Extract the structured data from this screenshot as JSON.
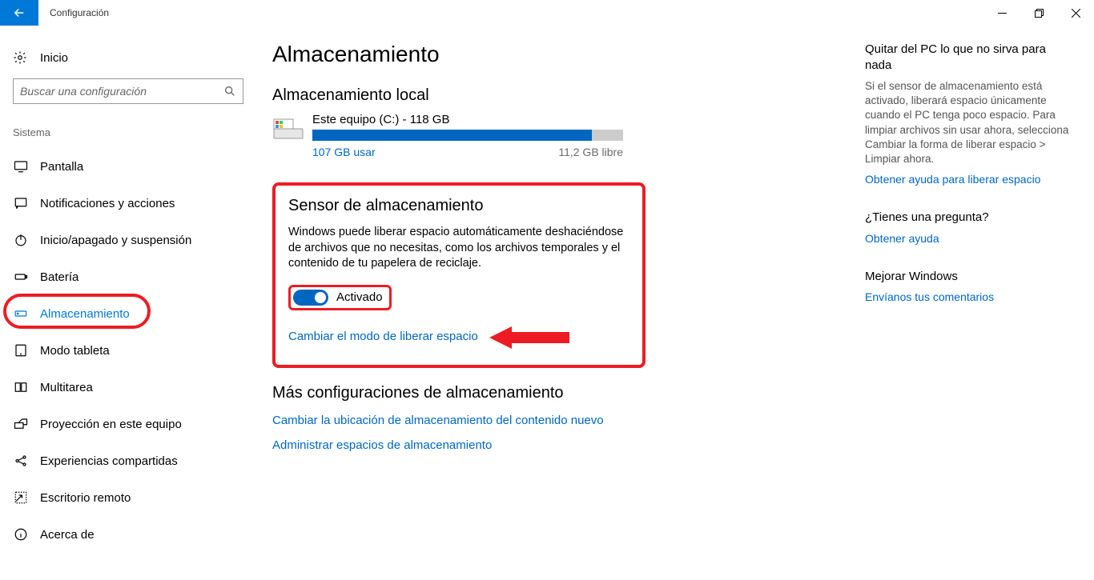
{
  "titlebar": {
    "app_title": "Configuración"
  },
  "sidebar": {
    "home_label": "Inicio",
    "search_placeholder": "Buscar una configuración",
    "group_label": "Sistema",
    "items": [
      {
        "label": "Pantalla",
        "icon": "display"
      },
      {
        "label": "Notificaciones y acciones",
        "icon": "chat"
      },
      {
        "label": "Inicio/apagado y suspensión",
        "icon": "power"
      },
      {
        "label": "Batería",
        "icon": "battery"
      },
      {
        "label": "Almacenamiento",
        "icon": "storage",
        "selected": true
      },
      {
        "label": "Modo tableta",
        "icon": "tablet"
      },
      {
        "label": "Multitarea",
        "icon": "multitask"
      },
      {
        "label": "Proyección en este equipo",
        "icon": "project"
      },
      {
        "label": "Experiencias compartidas",
        "icon": "share"
      },
      {
        "label": "Escritorio remoto",
        "icon": "remote"
      },
      {
        "label": "Acerca de",
        "icon": "info"
      }
    ]
  },
  "main": {
    "page_title": "Almacenamiento",
    "local_storage_heading": "Almacenamiento local",
    "drive": {
      "name": "Este equipo (C:) - 118 GB",
      "used_label": "107 GB usar",
      "free_label": "11,2 GB libre",
      "used_pct": 90
    },
    "sensor": {
      "heading": "Sensor de almacenamiento",
      "desc": "Windows puede liberar espacio automáticamente deshaciéndose de archivos que no necesitas, como los archivos temporales y el contenido de tu papelera de reciclaje.",
      "toggle_label": "Activado",
      "change_link": "Cambiar el modo de liberar espacio"
    },
    "more": {
      "heading": "Más configuraciones de almacenamiento",
      "link1": "Cambiar la ubicación de almacenamiento del contenido nuevo",
      "link2": "Administrar espacios de almacenamiento"
    }
  },
  "right": {
    "remove": {
      "heading": "Quitar del PC lo que no sirva para nada",
      "text": "Si el sensor de almacenamiento está activado, liberará espacio únicamente cuando el PC tenga poco espacio. Para limpiar archivos sin usar ahora, selecciona Cambiar la forma de liberar espacio > Limpiar ahora.",
      "link": "Obtener ayuda para liberar espacio"
    },
    "question": {
      "heading": "¿Tienes una pregunta?",
      "link": "Obtener ayuda"
    },
    "improve": {
      "heading": "Mejorar Windows",
      "link": "Envíanos tus comentarios"
    }
  }
}
